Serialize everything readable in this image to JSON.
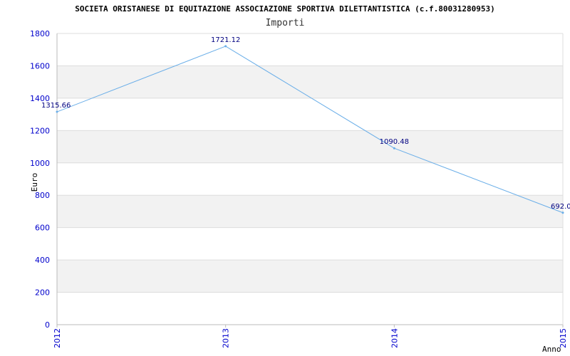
{
  "chart_data": {
    "type": "line",
    "title": "SOCIETA ORISTANESE DI EQUITAZIONE ASSOCIAZIONE SPORTIVA DILETTANTISTICA (c.f.80031280953)",
    "subtitle": "Importi",
    "xlabel": "Anno",
    "ylabel": "Euro",
    "categories": [
      "2012",
      "2013",
      "2014",
      "2015"
    ],
    "series": [
      {
        "values": [
          1315.66,
          1721.12,
          1090.48,
          692.0
        ]
      }
    ],
    "data_labels": [
      "1315.66",
      "1721.12",
      "1090.48",
      "692.0"
    ],
    "yticks": [
      0,
      200,
      400,
      600,
      800,
      1000,
      1200,
      1400,
      1600,
      1800
    ],
    "ylim": [
      0,
      1800
    ],
    "grid": true,
    "colors": {
      "line": "#6aaee8",
      "band": "#f2f2f2",
      "grid": "#dddddd",
      "tick_text": "#0000cc",
      "label_text": "#000080"
    }
  }
}
